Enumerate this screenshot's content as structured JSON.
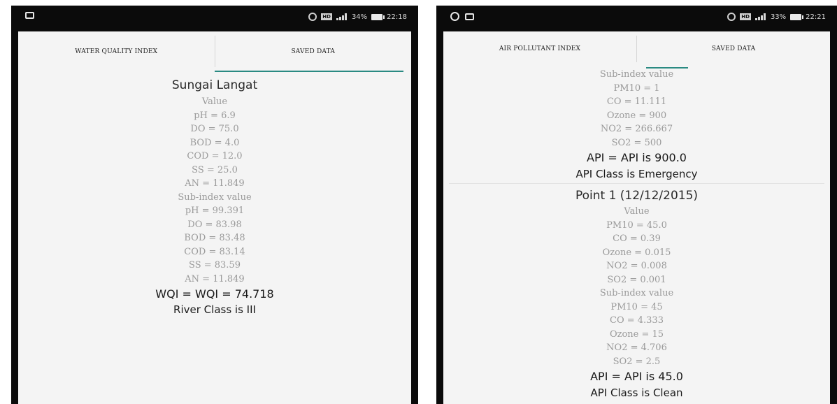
{
  "left": {
    "status": {
      "battery": "34%",
      "time": "22:18"
    },
    "tabs": [
      "WATER QUALITY INDEX",
      "SAVED DATA"
    ],
    "record": {
      "title": "Sungai Langat",
      "value_header": "Value",
      "values": [
        "pH = 6.9",
        "DO = 75.0",
        "BOD = 4.0",
        "COD = 12.0",
        "SS = 25.0",
        "AN = 11.849"
      ],
      "subindex_header": "Sub-index value",
      "subindex": [
        "pH = 99.391",
        "DO = 83.98",
        "BOD = 83.48",
        "COD = 83.14",
        "SS = 83.59",
        "AN = 11.849"
      ],
      "result": "WQI = WQI = 74.718",
      "class": "River Class is III"
    }
  },
  "right": {
    "status": {
      "battery": "33%",
      "time": "22:21"
    },
    "tabs": [
      "AIR POLLUTANT INDEX",
      "SAVED DATA"
    ],
    "record1": {
      "subindex_header": "Sub-index value",
      "subindex": [
        "PM10 = 1",
        "CO = 11.111",
        "Ozone = 900",
        "NO2 = 266.667",
        "SO2 = 500"
      ],
      "result": "API = API is 900.0",
      "class": "API Class is Emergency"
    },
    "record2": {
      "title": "Point 1 (12/12/2015)",
      "value_header": "Value",
      "values": [
        "PM10 = 45.0",
        "CO = 0.39",
        "Ozone = 0.015",
        "NO2 = 0.008",
        "SO2 = 0.001"
      ],
      "subindex_header": "Sub-index value",
      "subindex": [
        "PM10 = 45",
        "CO = 4.333",
        "Ozone = 15",
        "NO2 = 4.706",
        "SO2 = 2.5"
      ],
      "result": "API = API is 45.0",
      "class": "API Class is Clean"
    }
  },
  "colors": {
    "accent": "#2a8a82",
    "value_text": "#9a9a9a",
    "phone_frame": "#0b0b0b"
  }
}
